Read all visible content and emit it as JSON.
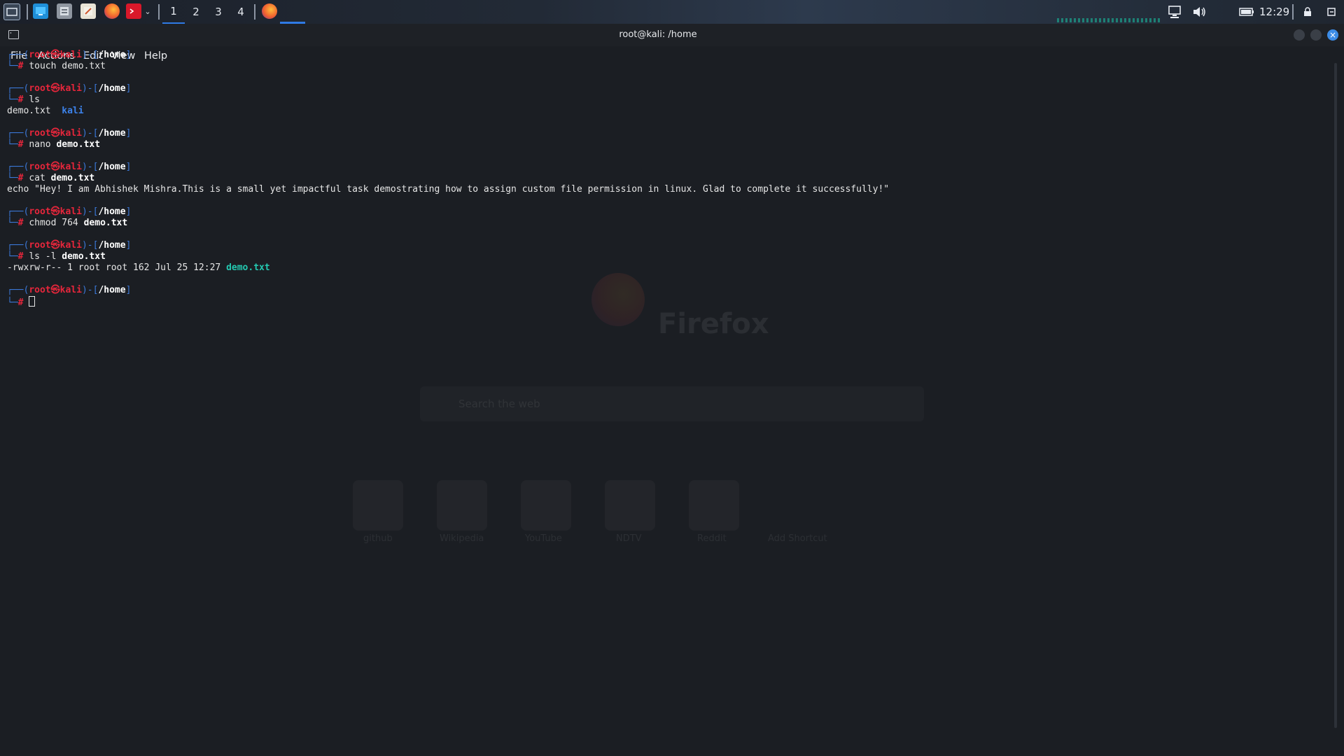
{
  "taskbar": {
    "workspaces": [
      "1",
      "2",
      "3",
      "4"
    ],
    "active_workspace": "1",
    "clock": "12:29",
    "accent": "#2f7ae5"
  },
  "window": {
    "title": "root@kali: /home",
    "menu": [
      "File",
      "Actions",
      "Edit",
      "View",
      "Help"
    ]
  },
  "terminal": {
    "user": "root",
    "at_symbol": "㉿",
    "host": "kali",
    "cwd": "/home",
    "prompt_char": "#",
    "sessions": [
      {
        "cmd": "touch",
        "arg": "demo.txt",
        "output": []
      },
      {
        "cmd": "ls",
        "arg": "",
        "output": [
          {
            "text": "demo.txt  ",
            "dir": "kali"
          }
        ]
      },
      {
        "cmd": "nano",
        "arg": "demo.txt",
        "output": []
      },
      {
        "cmd": "cat",
        "arg": "demo.txt",
        "output": [
          {
            "text": "echo \"Hey! I am Abhishek Mishra.This is a small yet impactful task demostrating how to assign custom file permission in linux. Glad to complete it successfully!\""
          }
        ]
      },
      {
        "cmd": "chmod",
        "arg": "764 demo.txt",
        "output": []
      },
      {
        "cmd": "ls -l",
        "arg": "demo.txt",
        "output": [
          {
            "text": "-rwxrw-r-- 1 root root 162 Jul 25 12:27 ",
            "file": "demo.txt"
          }
        ]
      }
    ],
    "colors": {
      "prompt": "#3b78d8",
      "user_host": "#e5263b",
      "dir": "#3c82ea",
      "exec_file": "#24c8b0"
    }
  },
  "background_firefox": {
    "brand": "Firefox",
    "search_placeholder": "Search the web",
    "shortcuts": [
      "github",
      "Wikipedia",
      "YouTube",
      "NDTV",
      "Reddit",
      "Add Shortcut"
    ]
  }
}
